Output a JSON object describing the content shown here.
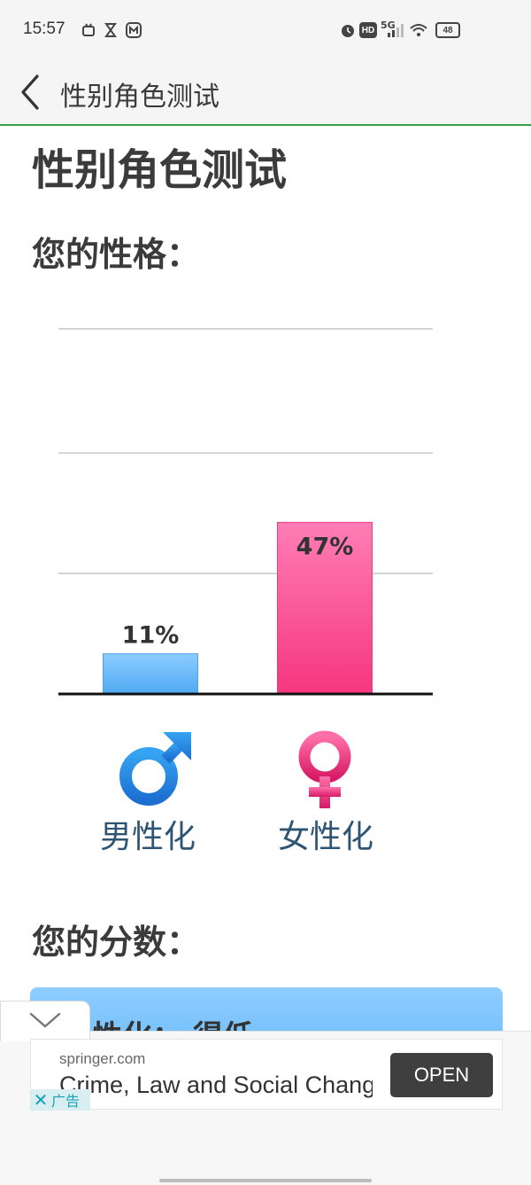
{
  "status_bar": {
    "time": "15:57",
    "left_icons": [
      "bilibili-tv-icon",
      "hourglass-icon",
      "app-m-icon"
    ],
    "right_icons": [
      "alarm-icon",
      "hd-icon",
      "signal-5g-icon",
      "wifi-icon",
      "battery-icon"
    ],
    "network_label": "5G",
    "hd_label": "HD",
    "battery_level": "48"
  },
  "app_bar": {
    "back_icon": "chevron-left-icon",
    "title": "性别角色测试"
  },
  "page": {
    "title": "性别角色测试",
    "personality_heading": "您的性格：",
    "score_heading": "您的分数：",
    "score_card_text": "性化： 得低"
  },
  "chart_data": {
    "type": "bar",
    "categories": [
      "男性化",
      "女性化"
    ],
    "values": [
      11,
      47
    ],
    "value_labels": [
      "11%",
      "47%"
    ],
    "ylim": [
      0,
      100
    ],
    "gridlines": [
      33,
      66,
      100
    ],
    "grid": true,
    "colors": {
      "男性化": "#5db2f5",
      "女性化": "#f2468c"
    },
    "category_icons": [
      "male-symbol-icon",
      "female-symbol-icon"
    ]
  },
  "ad": {
    "collapse_icon": "chevron-down-icon",
    "domain": "springer.com",
    "headline": "Crime, Law and Social Change",
    "open_label": "OPEN",
    "close_icon": "close-icon",
    "label": "广告"
  }
}
